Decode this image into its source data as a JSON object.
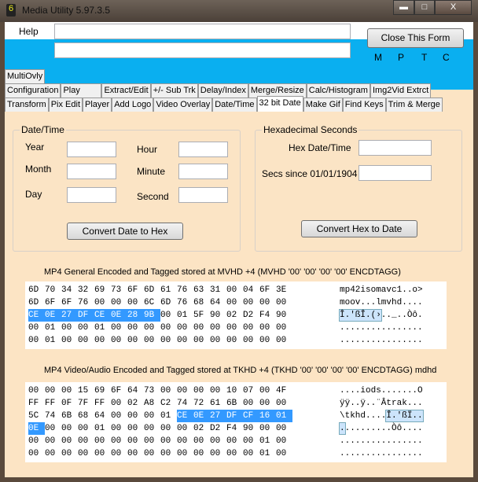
{
  "window": {
    "title": "Media Utility 5.97.3.5",
    "icon": "6",
    "minimize": "▬",
    "maximize": "□",
    "close": "X"
  },
  "top": {
    "help": "Help",
    "close_form": "Close This Form",
    "flags": [
      "M",
      "P",
      "T",
      "C"
    ]
  },
  "tabs": {
    "row1": [
      "MultiOvly"
    ],
    "row2": [
      "Configuration",
      "Play",
      "Extract/Edit",
      "+/- Sub Trk",
      "Delay/Index",
      "Merge/Resize",
      "Calc/Histogram",
      "Img2Vid Extrct"
    ],
    "row3": [
      "Transform",
      "Pix Edit",
      "Player",
      "Add Logo",
      "Video Overlay",
      "Date/Time",
      "32 bit Date",
      "Make Gif",
      "Find Keys",
      "Trim & Merge"
    ],
    "active": "32 bit Date"
  },
  "datetime": {
    "title": "Date/Time",
    "year": "Year",
    "month": "Month",
    "day": "Day",
    "hour": "Hour",
    "minute": "Minute",
    "second": "Second",
    "convert": "Convert Date to Hex"
  },
  "hexsec": {
    "title": "Hexadecimal Seconds",
    "hexdate": "Hex Date/Time",
    "secs": "Secs since 01/01/1904",
    "convert": "Convert Hex to Date"
  },
  "mvhd": {
    "caption": "MP4 General Encoded and Tagged stored at MVHD +4 (MVHD '00' '00' '00' '00' ENCDTAGG)",
    "rows": [
      {
        "hex": "6D 70 34 32 69 73 6F 6D 61 76 63 31 00 04 6F 3E",
        "ascii": "mp42isomavc1..o>"
      },
      {
        "hex": "6D 6F 6F 76 00 00 00 6C 6D 76 68 64 00 00 00 00",
        "ascii": "moov...lmvhd...."
      },
      {
        "hex": "CE 0E 27 DF CE 0E 28 9B 00 01 5F 90 02 D2 F4 90",
        "ascii": "Î.'ßÎ.(›.._..Òô."
      },
      {
        "hex": "00 01 00 00 01 00 00 00 00 00 00 00 00 00 00 00",
        "ascii": "................"
      },
      {
        "hex": "00 01 00 00 00 00 00 00 00 00 00 00 00 00 00 00",
        "ascii": "................"
      }
    ],
    "selection": [
      {
        "row": 2,
        "start": 0,
        "end": 8
      }
    ]
  },
  "tkhd": {
    "caption": "MP4 Video/Audio Encoded and Tagged stored at TKHD +4 (TKHD '00' '00' '00' '00' ENCDTAGG) mdhd",
    "rows": [
      {
        "hex": "00 00 00 15 69 6F 64 73 00 00 00 00 10 07 00 4F",
        "ascii": "....iods.......O"
      },
      {
        "hex": "FF FF 0F 7F FF 00 02 A8 C2 74 72 61 6B 00 00 00",
        "ascii": "ÿÿ..ÿ..¨Âtrak..."
      },
      {
        "hex": "5C 74 6B 68 64 00 00 00 01 CE 0E 27 DF CF 16 01",
        "ascii": "\\tkhd....Î.'ßÏ.."
      },
      {
        "hex": "0E 00 00 00 01 00 00 00 00 00 02 D2 F4 90 00 00",
        "ascii": "..........Òô...."
      },
      {
        "hex": "00 00 00 00 00 00 00 00 00 00 00 00 00 00 01 00",
        "ascii": "................"
      },
      {
        "hex": "00 00 00 00 00 00 00 00 00 00 00 00 00 00 01 00",
        "ascii": "................"
      }
    ],
    "selection": [
      {
        "row": 2,
        "start": 9,
        "end": 16
      },
      {
        "row": 3,
        "start": 0,
        "end": 1
      }
    ]
  }
}
